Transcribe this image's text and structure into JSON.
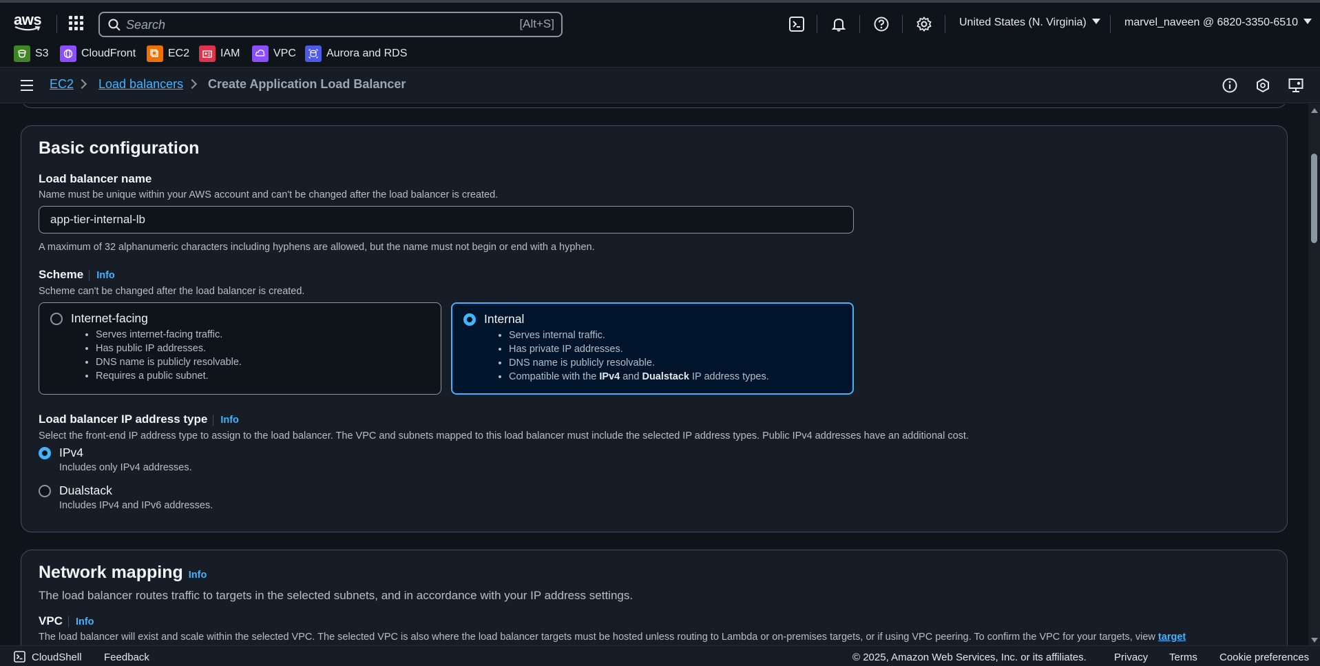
{
  "topbar": {
    "logo_text": "aws",
    "search_placeholder": "Search",
    "search_shortcut": "[Alt+S]",
    "region": "United States (N. Virginia)",
    "account": "marvel_naveen @ 6820-3350-6510"
  },
  "favorites": [
    {
      "label": "S3",
      "color": "#3f8624",
      "icon": "s3-icon"
    },
    {
      "label": "CloudFront",
      "color": "#8c4fff",
      "icon": "cloudfront-icon"
    },
    {
      "label": "EC2",
      "color": "#ed7100",
      "icon": "ec2-icon"
    },
    {
      "label": "IAM",
      "color": "#dd344c",
      "icon": "iam-icon"
    },
    {
      "label": "VPC",
      "color": "#8c4fff",
      "icon": "vpc-icon"
    },
    {
      "label": "Aurora and RDS",
      "color": "#4d5ae8",
      "icon": "rds-icon"
    }
  ],
  "breadcrumb": {
    "items": [
      "EC2",
      "Load balancers"
    ],
    "current": "Create Application Load Balancer"
  },
  "basic": {
    "title": "Basic configuration",
    "name_label": "Load balancer name",
    "name_desc": "Name must be unique within your AWS account and can't be changed after the load balancer is created.",
    "name_value": "app-tier-internal-lb",
    "name_constraint": "A maximum of 32 alphanumeric characters including hyphens are allowed, but the name must not begin or end with a hyphen.",
    "scheme_label": "Scheme",
    "info": "Info",
    "scheme_desc": "Scheme can't be changed after the load balancer is created.",
    "scheme_options": [
      {
        "title": "Internet-facing",
        "selected": false,
        "bullets": [
          "Serves internet-facing traffic.",
          "Has public IP addresses.",
          "DNS name is publicly resolvable.",
          "Requires a public subnet."
        ]
      },
      {
        "title": "Internal",
        "selected": true,
        "bullets": [
          "Serves internal traffic.",
          "Has private IP addresses.",
          "DNS name is publicly resolvable."
        ],
        "last_bullet": {
          "pre": "Compatible with the ",
          "b1": "IPv4",
          "mid": " and ",
          "b2": "Dualstack",
          "post": " IP address types."
        }
      }
    ],
    "ip_label": "Load balancer IP address type",
    "ip_desc": "Select the front-end IP address type to assign to the load balancer. The VPC and subnets mapped to this load balancer must include the selected IP address types. Public IPv4 addresses have an additional cost.",
    "ip_options": [
      {
        "title": "IPv4",
        "desc": "Includes only IPv4 addresses.",
        "selected": true
      },
      {
        "title": "Dualstack",
        "desc": "Includes IPv4 and IPv6 addresses.",
        "selected": false
      }
    ]
  },
  "network": {
    "title": "Network mapping",
    "info": "Info",
    "desc": "The load balancer routes traffic to targets in the selected subnets, and in accordance with your IP address settings.",
    "vpc_label": "VPC",
    "vpc_desc": "The load balancer will exist and scale within the selected VPC. The selected VPC is also where the load balancer targets must be hosted unless routing to Lambda or on-premises targets, or if using VPC peering. To confirm the VPC for your targets, view",
    "vpc_link": "target"
  },
  "footer": {
    "cloudshell": "CloudShell",
    "feedback": "Feedback",
    "copyright": "© 2025, Amazon Web Services, Inc. or its affiliates.",
    "privacy": "Privacy",
    "terms": "Terms",
    "cookies": "Cookie preferences"
  },
  "colors": {
    "accent": "#42b4ff",
    "bg": "#0f141a",
    "card": "#161d26"
  }
}
